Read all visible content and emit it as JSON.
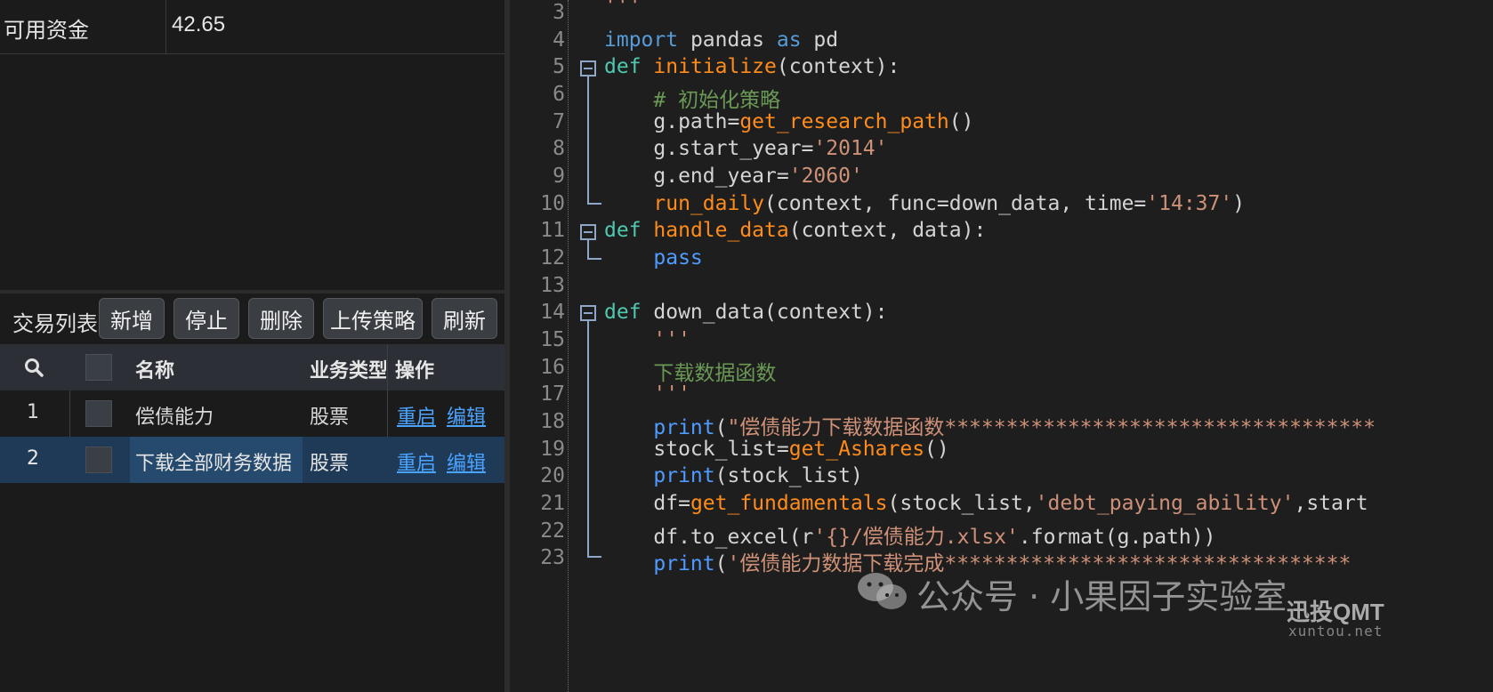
{
  "account": {
    "label": "可用资金",
    "value": "42.65"
  },
  "toolbar": {
    "title": "交易列表",
    "buttons": [
      "新增",
      "停止",
      "删除",
      "上传策略",
      "刷新"
    ]
  },
  "table": {
    "headers": [
      "名称",
      "业务类型",
      "操作"
    ],
    "rows": [
      {
        "index": "1",
        "name": "偿债能力",
        "type": "股票",
        "action1": "重启",
        "action2": "编辑",
        "selected": false
      },
      {
        "index": "2",
        "name": "下载全部财务数据",
        "type": "股票",
        "action1": "重启",
        "action2": "编辑",
        "selected": true
      }
    ]
  },
  "editor": {
    "line_numbers": [
      "3",
      "4",
      "5",
      "6",
      "7",
      "8",
      "9",
      "10",
      "11",
      "12",
      "13",
      "14",
      "15",
      "16",
      "17",
      "18",
      "19",
      "20",
      "21",
      "22",
      "23"
    ]
  },
  "watermark": {
    "text": "公众号 · 小果因子实验室",
    "brand": "迅投QMT",
    "url": "xuntou.net"
  },
  "colors": {
    "selected_row": "#1e3a57",
    "link": "#4aa3ff",
    "keyword": "#569cd6",
    "function": "#ff8c1a",
    "string": "#ce9178",
    "comment": "#6a9955"
  }
}
